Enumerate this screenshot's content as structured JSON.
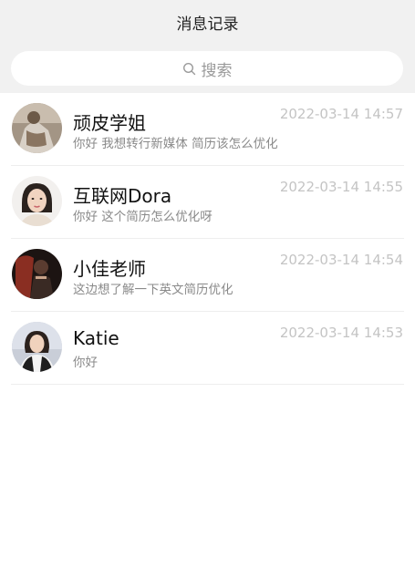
{
  "header": {
    "title": "消息记录"
  },
  "search": {
    "placeholder": "搜索",
    "icon": "search-icon"
  },
  "chats": [
    {
      "name": "顽皮学姐",
      "preview": "你好 我想转行新媒体 简历该怎么优化",
      "time": "2022-03-14 14:57"
    },
    {
      "name": "互联网Dora",
      "preview": "你好 这个简历怎么优化呀",
      "time": "2022-03-14 14:55"
    },
    {
      "name": "小佳老师",
      "preview": "这边想了解一下英文简历优化",
      "time": "2022-03-14 14:54"
    },
    {
      "name": "Katie",
      "preview": "你好",
      "time": "2022-03-14 14:53"
    }
  ],
  "colors": {
    "header_bg": "#f1f1f1",
    "placeholder": "#9a9a9a",
    "time": "#c4c4c4",
    "preview": "#8a8a8a"
  }
}
